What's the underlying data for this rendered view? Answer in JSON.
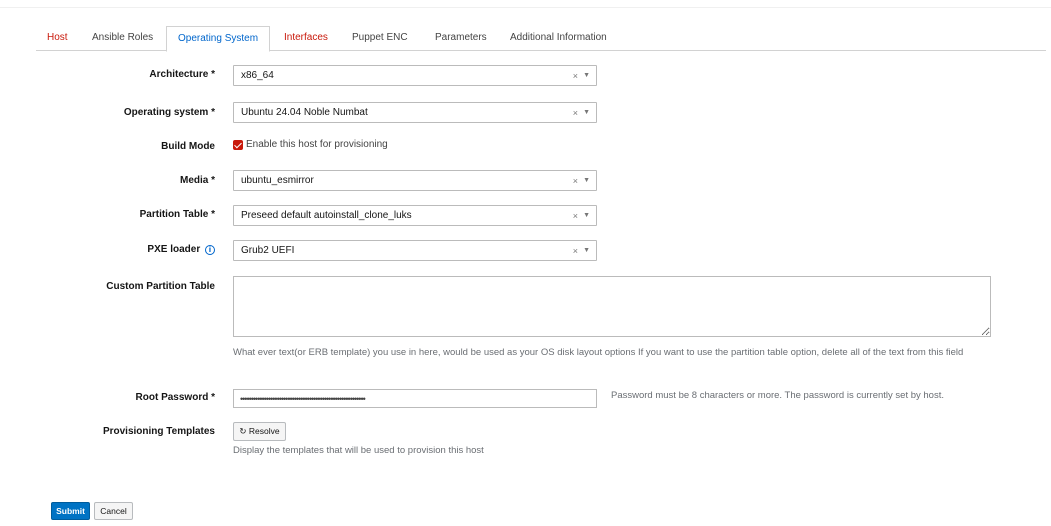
{
  "tabs": [
    {
      "label": "Host",
      "state": "error"
    },
    {
      "label": "Ansible Roles",
      "state": "normal"
    },
    {
      "label": "Operating System",
      "state": "active"
    },
    {
      "label": "Interfaces",
      "state": "error"
    },
    {
      "label": "Puppet ENC",
      "state": "normal"
    },
    {
      "label": "Parameters",
      "state": "normal"
    },
    {
      "label": "Additional Information",
      "state": "normal"
    }
  ],
  "form": {
    "architecture": {
      "label": "Architecture *",
      "value": "x86_64"
    },
    "operating_system": {
      "label": "Operating system *",
      "value": "Ubuntu 24.04 Noble Numbat"
    },
    "build_mode": {
      "label": "Build Mode",
      "checkbox_label": "Enable this host for provisioning",
      "checked": true
    },
    "media": {
      "label": "Media *",
      "value": "ubuntu_esmirror"
    },
    "partition_table": {
      "label": "Partition Table *",
      "value": "Preseed default autoinstall_clone_luks"
    },
    "pxe_loader": {
      "label": "PXE loader",
      "value": "Grub2 UEFI"
    },
    "custom_partition_table": {
      "label": "Custom Partition Table",
      "value": "",
      "help": "What ever text(or ERB template) you use in here, would be used as your OS disk layout options If you want to use the partition table option, delete all of the text from this field"
    },
    "root_password": {
      "label": "Root Password *",
      "value": "••••••••••••••••••••••••••••••••••••••••••••••••••••••••••",
      "help": "Password must be 8 characters or more. The password is currently set by host."
    },
    "provisioning_templates": {
      "label": "Provisioning Templates",
      "button_label": "Resolve",
      "help": "Display the templates that will be used to provision this host"
    }
  },
  "select_controls": {
    "clear": "×",
    "arrow": "▼"
  },
  "icons": {
    "info": "i",
    "refresh": "↻"
  },
  "buttons": {
    "submit": "Submit",
    "cancel": "Cancel"
  },
  "colors": {
    "accent": "#0066cc",
    "error": "#c9190b",
    "primary_button": "#0073c4"
  }
}
